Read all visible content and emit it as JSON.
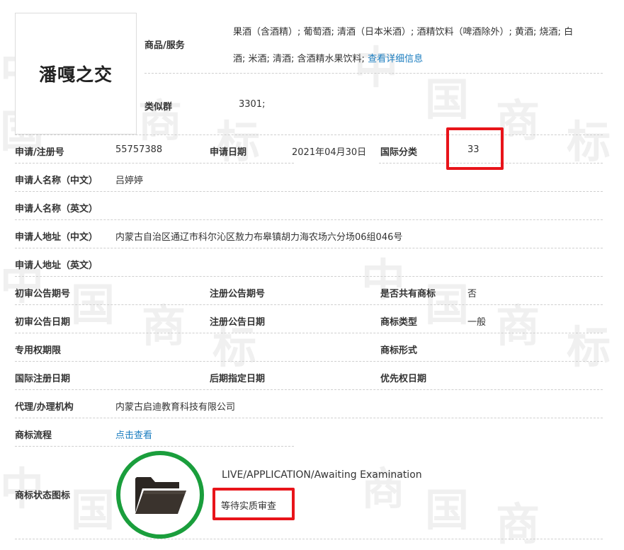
{
  "trademark": {
    "logo_text": "潘嘎之交",
    "goods_label": "商品/服务",
    "goods_line1": "果酒（含酒精）; 葡萄酒; 清酒（日本米酒）; 酒精饮料（啤酒除外）; 黄酒; 烧酒; 白",
    "goods_line2": "酒; 米酒; 清酒; 含酒精水果饮料;",
    "goods_more_link": "查看详细信息",
    "similar_group_label": "类似群",
    "similar_group_value": "3301;"
  },
  "fields": {
    "reg_no_label": "申请/注册号",
    "reg_no_value": "55757388",
    "apply_date_label": "申请日期",
    "apply_date_value": "2021年04月30日",
    "intl_class_label": "国际分类",
    "intl_class_value": "33",
    "applicant_cn_label": "申请人名称（中文）",
    "applicant_cn_value": "吕婷婷",
    "applicant_en_label": "申请人名称（英文）",
    "address_cn_label": "申请人地址（中文）",
    "address_cn_value": "内蒙古自治区通辽市科尔沁区敖力布皋镇胡力海农场六分场06组046号",
    "address_en_label": "申请人地址（英文）",
    "prelim_pub_no_label": "初审公告期号",
    "reg_pub_no_label": "注册公告期号",
    "shared_label": "是否共有商标",
    "shared_value": "否",
    "prelim_pub_date_label": "初审公告日期",
    "reg_pub_date_label": "注册公告日期",
    "tm_type_label": "商标类型",
    "tm_type_value": "一般",
    "exclusive_period_label": "专用权期限",
    "tm_form_label": "商标形式",
    "intl_reg_date_label": "国际注册日期",
    "later_designation_label": "后期指定日期",
    "priority_date_label": "优先权日期",
    "agency_label": "代理/办理机构",
    "agency_value": "内蒙古启迪教育科技有限公司",
    "process_label": "商标流程",
    "process_link": "点击查看",
    "status_icon_label": "商标状态图标",
    "status_en": "LIVE/APPLICATION/Awaiting Examination",
    "status_cn": "等待实质审查"
  },
  "watermark": {
    "chars": [
      "中",
      "国",
      "商",
      "标"
    ]
  },
  "colors": {
    "link": "#1a7cbf",
    "highlight": "#e8141a",
    "status_ring": "#1a9e3c"
  },
  "icons": [
    "folder-icon"
  ]
}
